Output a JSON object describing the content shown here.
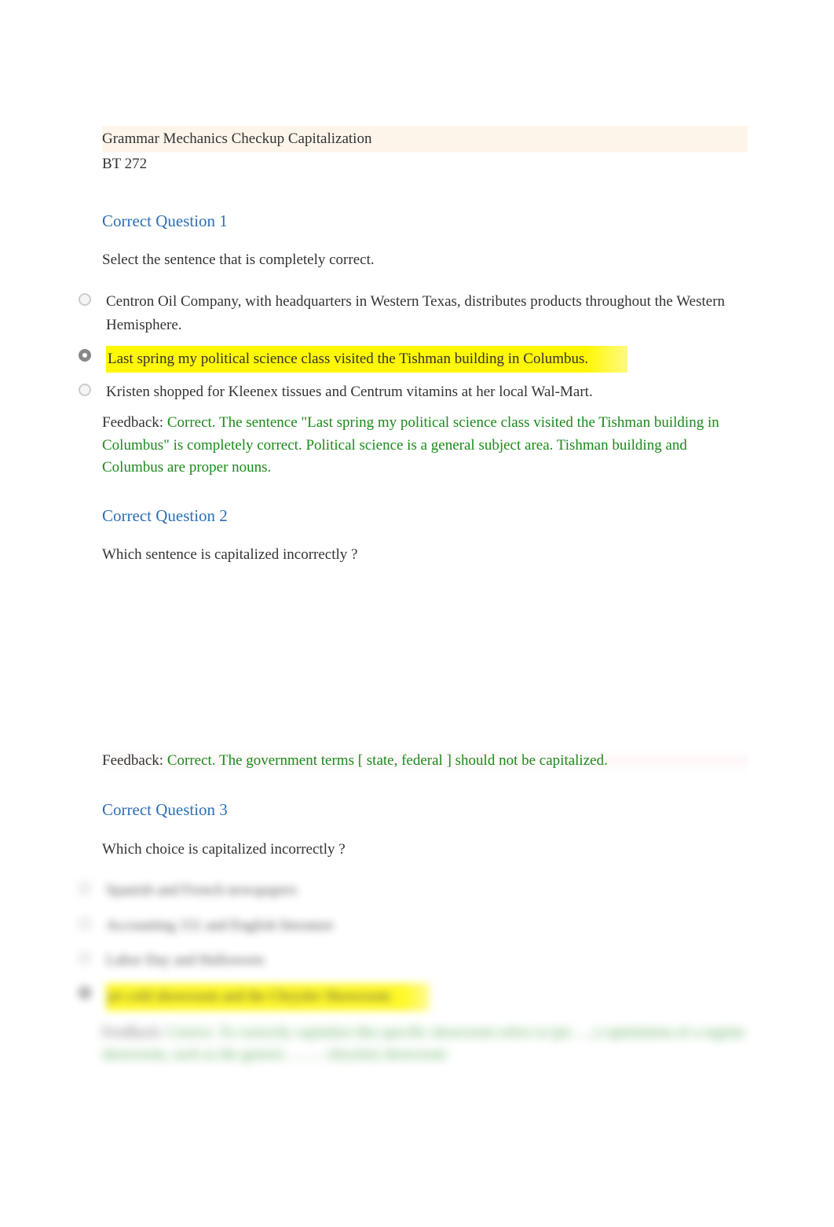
{
  "header": {
    "title": "Grammar Mechanics Checkup Capitalization",
    "subtitle": "BT 272"
  },
  "q1": {
    "heading": "Correct Question 1",
    "prompt": "Select the sentence that is completely correct.",
    "options": [
      "Centron Oil Company, with headquarters in Western Texas, distributes products throughout the Western Hemisphere.",
      "Last spring my political science class visited the Tishman building in Columbus.",
      "Kristen shopped for Kleenex tissues and Centrum vitamins at her local Wal-Mart."
    ],
    "feedback_label": "Feedback:   ",
    "feedback": "Correct. The sentence \"Last spring my political science class visited the Tishman building in Columbus\" is completely correct.     Political science   is a general subject area.      Tishman building and  Columbus   are proper nouns."
  },
  "q2": {
    "heading": "Correct Question 2",
    "prompt": "Which sentence is capitalized incorrectly      ?",
    "feedback_label": "Feedback:   ",
    "feedback": "Correct. The government terms [      state, federal   ] should not be capitalized."
  },
  "q3": {
    "heading": "Correct Question 3",
    "prompt": "Which choice is capitalized incorrectly     ?",
    "options": [
      "Spanish and French newspapers",
      "Accounting 151 and English literature",
      "Labor Day and Halloween",
      "jet cold showroom and the Chrysler Showroom"
    ],
    "feedback_label": "Feedback:  ",
    "feedback": "Correct. To correctly capitalize this specific showroom refers to (jet ….)  capitulation of a regular showroom, such as the generic  …….  chrysler( showroom"
  }
}
